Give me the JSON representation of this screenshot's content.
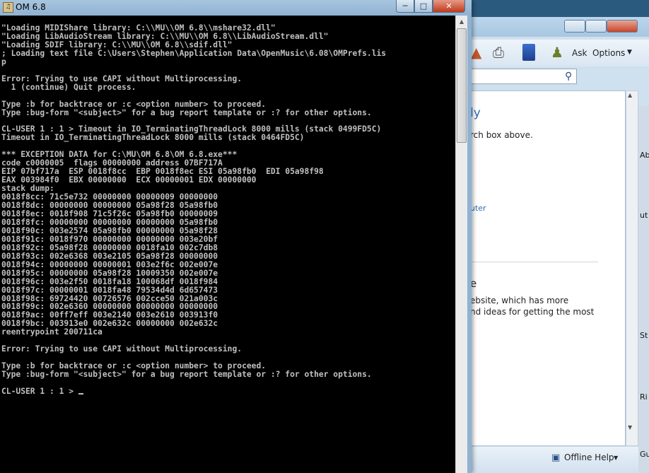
{
  "console": {
    "title": "OM 6.8",
    "lines": [
      "\"Loading MIDIShare library: C:\\\\MU\\\\OM 6.8\\\\mshare32.dll\"",
      "\"Loading LibAudioStream library: C:\\\\MU\\\\OM 6.8\\\\LibAudioStream.dll\"",
      "\"Loading SDIF library: C:\\\\MU\\\\OM 6.8\\\\sdif.dll\"",
      "; Loading text file C:\\Users\\Stephen\\Application Data\\OpenMusic\\6.08\\OMPrefs.lis",
      "p",
      "",
      "Error: Trying to use CAPI without Multiprocessing.",
      "  1 (continue) Quit process.",
      "",
      "Type :b for backtrace or :c <option number> to proceed.",
      "Type :bug-form \"<subject>\" for a bug report template or :? for other options.",
      "",
      "CL-USER 1 : 1 > Timeout in IO_TerminatingThreadLock 8000 mills (stack 0499FD5C)",
      "Timeout in IO_TerminatingThreadLock 8000 mills (stack 0464FD5C)",
      "",
      "*** EXCEPTION DATA for C:\\MU\\OM 6.8\\OM 6.8.exe***",
      "code c0000005  flags 00000000 address 07BF717A",
      "EIP 07bf717a  ESP 0018f8cc  EBP 0018f8ec ESI 05a98fb0  EDI 05a98f98",
      "EAX 003984f0  EBX 00000000  ECX 00000001 EDX 00000000",
      "stack dump:",
      "0018f8cc: 71c5e732 00000000 00000009 00000000",
      "0018f8dc: 00000000 00000000 05a98f28 05a98fb0",
      "0018f8ec: 0018f908 71c5f26c 05a98fb0 00000009",
      "0018f8fc: 00000000 00000000 00000000 05a98fb0",
      "0018f90c: 003e2574 05a98fb0 00000000 05a98f28",
      "0018f91c: 0018f970 00000000 00000000 003e20bf",
      "0018f92c: 05a98f28 00000000 0018fa10 002c7db8",
      "0018f93c: 002e6368 003e2105 05a98f28 00000000",
      "0018f94c: 00000000 00000001 003e2f6c 002e007e",
      "0018f95c: 00000000 05a98f28 10009350 002e007e",
      "0018f96c: 003e2f50 0018fa18 100068df 0018f984",
      "0018f97c: 00000001 0018fa48 79534d4d 6d657473",
      "0018f98c: 69724420 00726576 002cce50 021a003c",
      "0018f99c: 002e6360 00000000 00000000 00000000",
      "0018f9ac: 00ff7eff 003e2140 003e2610 003913f0",
      "0018f9bc: 003913e0 002e632c 00000000 002e632c",
      "reentrypoint 200711ca",
      "",
      "Error: Trying to use CAPI without Multiprocessing.",
      "",
      "Type :b for backtrace or :c <option number> to proceed.",
      "Type :bug-form \"<subject>\" for a bug report template or :? for other options.",
      ""
    ],
    "prompt": "CL-USER 1 : 1 > "
  },
  "help_window": {
    "toolbar": {
      "ask_label": "Ask",
      "options_label": "Options"
    },
    "content": {
      "heading_fragment": "ly",
      "line1": "rch box above.",
      "link_fragment": "uter",
      "heading2_fragment": "e",
      "line2": "ebsite, which has more",
      "line3": "nd ideas for getting the most"
    },
    "status": {
      "offline_help": "Offline Help"
    }
  },
  "edge_labels": [
    "Ab",
    "ut",
    "St",
    "Ri",
    "Gu"
  ],
  "colors": {
    "terminal_bg": "#000000",
    "terminal_fg": "#c0c0c0",
    "link": "#2a6db6"
  }
}
